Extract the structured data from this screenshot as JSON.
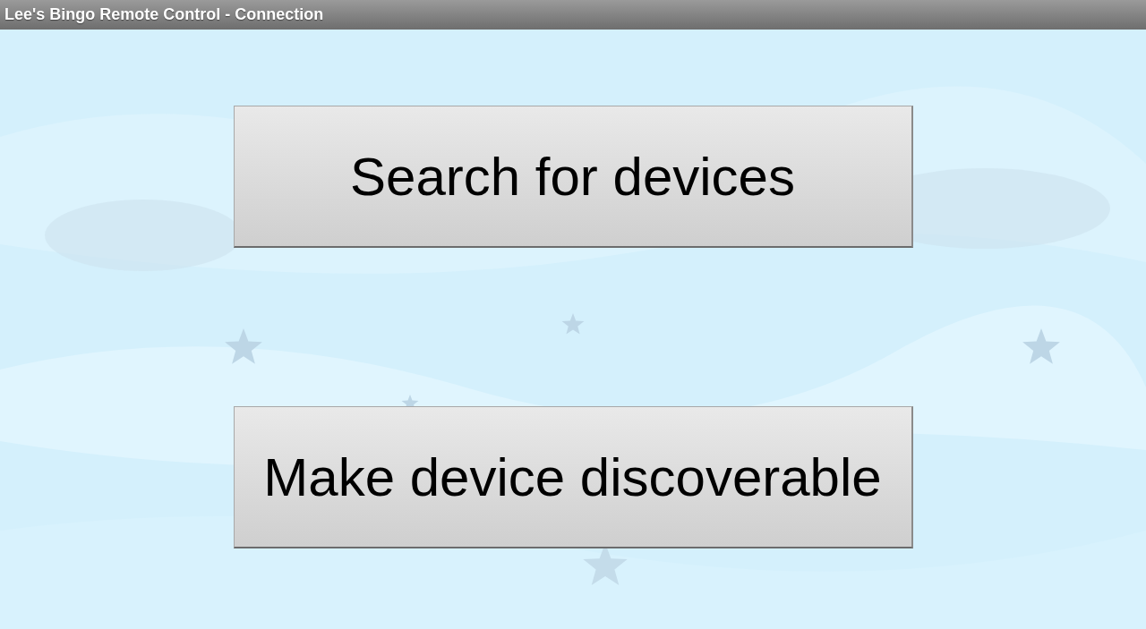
{
  "window": {
    "title": "Lee's Bingo Remote Control - Connection"
  },
  "buttons": [
    {
      "label": "Search for devices"
    },
    {
      "label": "Make device discoverable"
    }
  ]
}
